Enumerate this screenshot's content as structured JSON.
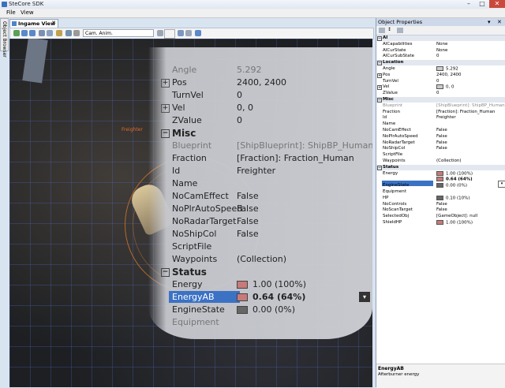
{
  "window": {
    "title": "SteCore SDK"
  },
  "menu": [
    "File",
    "View"
  ],
  "side_tab": "Object Browser",
  "doc_tab": {
    "label": "Ingame View"
  },
  "toolbar": {
    "camera_mode": "Cam. Anim."
  },
  "viewport": {
    "object_label": "Freighter"
  },
  "zoom": {
    "rows": [
      {
        "kind": "row",
        "key": "Angle",
        "value": "5.292",
        "grey": true,
        "partial": true
      },
      {
        "kind": "row",
        "key": "Pos",
        "value": "2400, 2400",
        "expand": true
      },
      {
        "kind": "row",
        "key": "TurnVel",
        "value": "0"
      },
      {
        "kind": "row",
        "key": "Vel",
        "value": "0, 0",
        "expand": true
      },
      {
        "kind": "row",
        "key": "ZValue",
        "value": "0"
      },
      {
        "kind": "sec",
        "key": "Misc"
      },
      {
        "kind": "row",
        "key": "Blueprint",
        "value": "[ShipBlueprint]: ShipBP_HumanFreig",
        "grey": true
      },
      {
        "kind": "row",
        "key": "Fraction",
        "value": "[Fraction]: Fraction_Human"
      },
      {
        "kind": "row",
        "key": "Id",
        "value": "Freighter"
      },
      {
        "kind": "row",
        "key": "Name",
        "value": ""
      },
      {
        "kind": "row",
        "key": "NoCamEffect",
        "value": "False"
      },
      {
        "kind": "row",
        "key": "NoPlrAutoSpeed",
        "value": "False"
      },
      {
        "kind": "row",
        "key": "NoRadarTarget",
        "value": "False"
      },
      {
        "kind": "row",
        "key": "NoShipCol",
        "value": "False"
      },
      {
        "kind": "row",
        "key": "ScriptFile",
        "value": ""
      },
      {
        "kind": "row",
        "key": "Waypoints",
        "value": "(Collection)"
      },
      {
        "kind": "sec",
        "key": "Status"
      },
      {
        "kind": "row",
        "key": "Energy",
        "value": "1.00 (100%)",
        "swatch": "#c77a7a"
      },
      {
        "kind": "row",
        "key": "EnergyAB",
        "value": "0.64 (64%)",
        "swatch": "#c77a7a",
        "selected": true,
        "bold": true
      },
      {
        "kind": "row",
        "key": "EngineState",
        "value": "0.00 (0%)",
        "swatch": "#666"
      },
      {
        "kind": "row",
        "key": "Equipment",
        "value": "",
        "grey": true,
        "partial": true
      }
    ]
  },
  "panel": {
    "title": "Object Properties",
    "pin": "▾",
    "close": "✕",
    "rows": [
      {
        "kind": "sec",
        "key": "AI"
      },
      {
        "kind": "row",
        "key": "AICapabilities",
        "value": "None"
      },
      {
        "kind": "row",
        "key": "AICurState",
        "value": "None"
      },
      {
        "kind": "row",
        "key": "AICurSubState",
        "value": "0"
      },
      {
        "kind": "sec",
        "key": "Location"
      },
      {
        "kind": "row",
        "key": "Angle",
        "value": "5.292",
        "swatch": "#ccc"
      },
      {
        "kind": "row",
        "key": "Pos",
        "value": "2400, 2400",
        "expand": true
      },
      {
        "kind": "row",
        "key": "TurnVel",
        "value": "0"
      },
      {
        "kind": "row",
        "key": "Vel",
        "value": "0, 0",
        "expand": true,
        "swatch": "#ccc"
      },
      {
        "kind": "row",
        "key": "ZValue",
        "value": "0"
      },
      {
        "kind": "sec",
        "key": "Misc"
      },
      {
        "kind": "row",
        "key": "Blueprint",
        "value": "[ShipBlueprint]: ShipBP_HumanFrei",
        "grey": true
      },
      {
        "kind": "row",
        "key": "Fraction",
        "value": "[Fraction]: Fraction_Human"
      },
      {
        "kind": "row",
        "key": "Id",
        "value": "Freighter"
      },
      {
        "kind": "row",
        "key": "Name",
        "value": ""
      },
      {
        "kind": "row",
        "key": "NoCamEffect",
        "value": "False"
      },
      {
        "kind": "row",
        "key": "NoPlrAutoSpeed",
        "value": "False"
      },
      {
        "kind": "row",
        "key": "NoRadarTarget",
        "value": "False"
      },
      {
        "kind": "row",
        "key": "NoShipCol",
        "value": "False"
      },
      {
        "kind": "row",
        "key": "ScriptFile",
        "value": ""
      },
      {
        "kind": "row",
        "key": "Waypoints",
        "value": "(Collection)"
      },
      {
        "kind": "sec",
        "key": "Status"
      },
      {
        "kind": "row",
        "key": "Energy",
        "value": "1.00 (100%)",
        "swatch": "#c77a7a"
      },
      {
        "kind": "row",
        "key": "EnergyAB",
        "value": "0.64 (64%)",
        "swatch": "#c77a7a",
        "selected": true,
        "bold": true
      },
      {
        "kind": "row",
        "key": "EngineState",
        "value": "0.00 (0%)",
        "swatch": "#666"
      },
      {
        "kind": "row",
        "key": "Equipment",
        "value": ""
      },
      {
        "kind": "row",
        "key": "HP",
        "value": "0.10 (10%)",
        "swatch": "#666"
      },
      {
        "kind": "row",
        "key": "NoControls",
        "value": "False"
      },
      {
        "kind": "row",
        "key": "NoScanTarget",
        "value": "False"
      },
      {
        "kind": "row",
        "key": "SelectedObj",
        "value": "[GameObject]: null"
      },
      {
        "kind": "row",
        "key": "ShieldHP",
        "value": "1.00 (100%)",
        "swatch": "#c77a7a"
      }
    ],
    "description": {
      "name": "EnergyAB",
      "text": "Afterburner energy"
    }
  }
}
